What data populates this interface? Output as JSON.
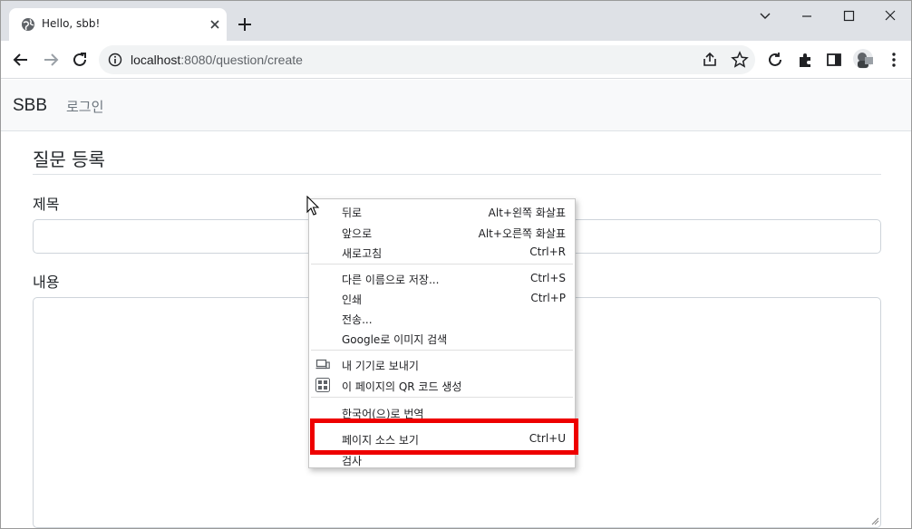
{
  "browser": {
    "tab_title": "Hello, sbb!",
    "url_host": "localhost",
    "url_rest": ":8080/question/create"
  },
  "navbar": {
    "brand": "SBB",
    "login_link": "로그인"
  },
  "form": {
    "page_title": "질문 등록",
    "subject_label": "제목",
    "subject_value": "",
    "content_label": "내용",
    "content_value": ""
  },
  "context_menu": {
    "back": {
      "label": "뒤로",
      "shortcut": "Alt+왼쪽 화살표"
    },
    "forward": {
      "label": "앞으로",
      "shortcut": "Alt+오른쪽 화살표"
    },
    "reload": {
      "label": "새로고침",
      "shortcut": "Ctrl+R"
    },
    "save_as": {
      "label": "다른 이름으로 저장...",
      "shortcut": "Ctrl+S"
    },
    "print": {
      "label": "인쇄",
      "shortcut": "Ctrl+P"
    },
    "cast": {
      "label": "전송..."
    },
    "google_image": {
      "label": "Google로 이미지 검색"
    },
    "send_to_devices": {
      "label": "내 기기로 보내기"
    },
    "qr_code": {
      "label": "이 페이지의 QR 코드 생성"
    },
    "translate": {
      "label": "한국어(으)로 번역"
    },
    "view_source": {
      "label": "페이지 소스 보기",
      "shortcut": "Ctrl+U"
    },
    "inspect": {
      "label": "검사"
    }
  },
  "colors": {
    "highlight_border": "#ee0000",
    "tabstrip_bg": "#dee1e6",
    "navbar_bg": "#f8f9fa"
  },
  "icons": {
    "tab_favicon": "globe-icon",
    "new_tab": "plus-icon",
    "back": "arrow-left-icon",
    "forward": "arrow-right-icon",
    "reload": "reload-icon",
    "site_info": "info-icon",
    "share": "share-icon",
    "bookmark": "star-icon",
    "extensions": "puzzle-icon",
    "side_panel": "side-panel-icon",
    "menu": "kebab-menu-icon"
  }
}
